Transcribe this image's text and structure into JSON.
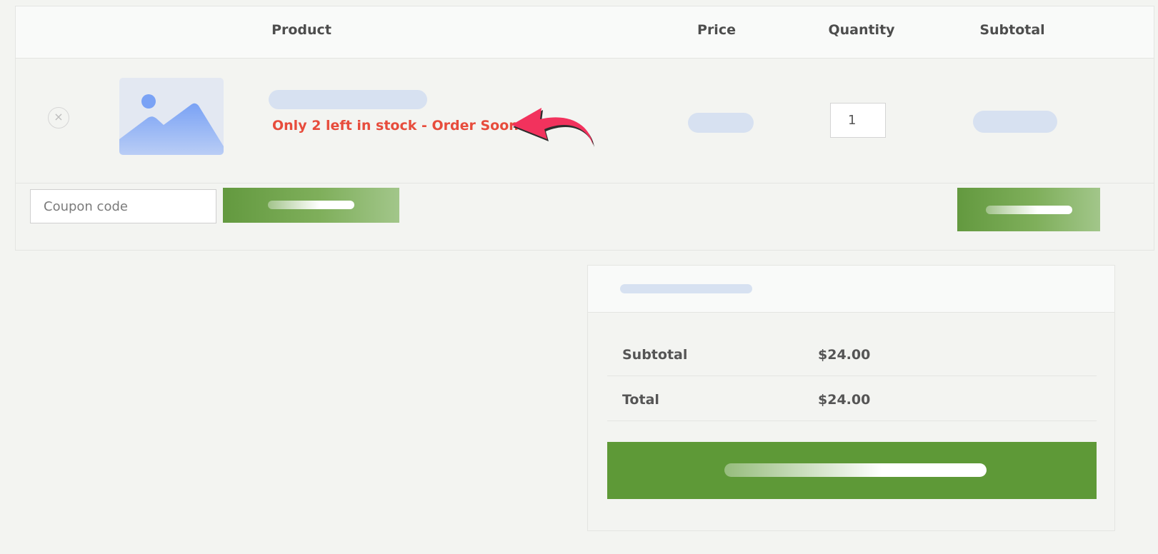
{
  "cart": {
    "columns": {
      "product": "Product",
      "price": "Price",
      "quantity": "Quantity",
      "subtotal": "Subtotal"
    },
    "item": {
      "remove_icon": "×",
      "stock_note": "Only 2 left in stock - Order Soon",
      "quantity": "1"
    },
    "coupon": {
      "placeholder": "Coupon code"
    }
  },
  "totals": {
    "rows": [
      {
        "label": "Subtotal",
        "value": "$24.00"
      },
      {
        "label": "Total",
        "value": "$24.00"
      }
    ]
  },
  "colors": {
    "accent_green": "#5e9937",
    "alert_red": "#e74c3c",
    "arrow_pink": "#f2325d",
    "skeleton": "#d7e1f1"
  },
  "icons": {
    "remove": "close-circle-icon",
    "thumbnail": "image-placeholder-icon",
    "pointer": "curved-arrow-icon"
  }
}
